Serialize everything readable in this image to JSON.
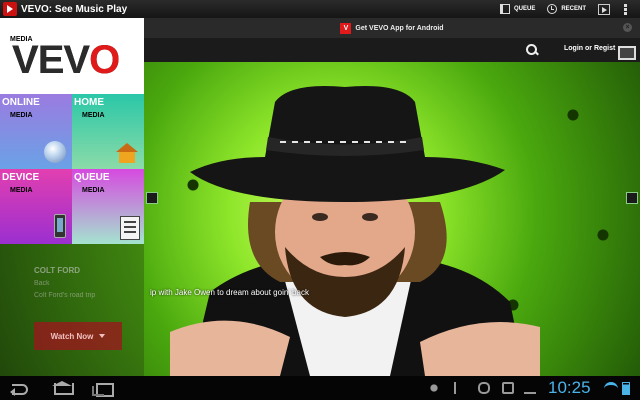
{
  "app": {
    "title": "VEVO: See Music Play",
    "actions": [
      {
        "label": "QUEUE",
        "icon": "queue-icon"
      },
      {
        "label": "RECENT",
        "icon": "clock-icon"
      }
    ]
  },
  "promo": {
    "text": "Get VEVO App for Android"
  },
  "nav": {
    "login": "Login or Regist"
  },
  "drawer": {
    "logo_media": "MEDIA",
    "logo_text": "VEVO",
    "tiles": [
      {
        "title": "ONLINE",
        "subtitle": "MEDIA",
        "icon": "globe-icon"
      },
      {
        "title": "HOME",
        "subtitle": "MEDIA",
        "icon": "house-icon"
      },
      {
        "title": "DEVICE",
        "subtitle": "MEDIA",
        "icon": "phone-icon"
      },
      {
        "title": "QUEUE",
        "subtitle": "MEDIA",
        "icon": "checklist-icon"
      }
    ]
  },
  "hero": {
    "caption": "ip with Jake Owen to dream about goin' back",
    "artist": "COLT FORD",
    "song": "Back",
    "blurb": "Colt Ford's road trip",
    "watch": "Watch Now"
  },
  "status": {
    "clock": "10:25"
  },
  "colors": {
    "brand": "#e01a1a",
    "clock": "#4ab3e8",
    "hero_green": "#8ee62a"
  }
}
